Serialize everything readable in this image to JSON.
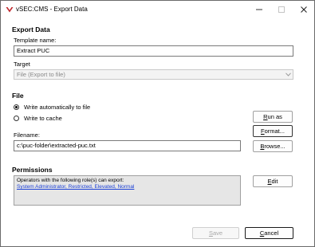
{
  "window": {
    "title": "vSEC:CMS - Export Data",
    "icons": {
      "app": "app-logo-icon",
      "minimize": "minimize-icon",
      "maximize": "maximize-icon",
      "close": "close-icon"
    }
  },
  "export_data": {
    "section_title": "Export Data",
    "template_name_label": "Template name:",
    "template_name_value": "Extract PUC",
    "target_label": "Target",
    "target_value": "File (Export to file)"
  },
  "file": {
    "section_title": "File",
    "radio_write_auto": "Write automatically to file",
    "radio_write_auto_checked": true,
    "radio_write_cache": "Write to cache",
    "radio_write_cache_checked": false,
    "filename_label": "Filename:",
    "filename_value": "c:\\puc-folder\\extracted-puc.txt",
    "run_as_prefix": "",
    "run_as_key": "R",
    "run_as_rest": "un as",
    "format_prefix": "",
    "format_key": "F",
    "format_rest": "ormat...",
    "browse_prefix": "",
    "browse_key": "B",
    "browse_rest": "rowse..."
  },
  "permissions": {
    "section_title": "Permissions",
    "description": "Operators with the following role(s) can export:",
    "roles_link": "System Administrator, Restricted, Elevated, Normal",
    "edit_prefix": "",
    "edit_key": "E",
    "edit_rest": "dit"
  },
  "footer": {
    "save_prefix": "",
    "save_key": "S",
    "save_rest": "ave",
    "save_enabled": false,
    "cancel_prefix": "",
    "cancel_key": "C",
    "cancel_rest": "ancel"
  },
  "colors": {
    "link": "#1a3fd6",
    "disabled_text": "#a8a8a8",
    "permissions_bg": "#e6e6e6"
  }
}
